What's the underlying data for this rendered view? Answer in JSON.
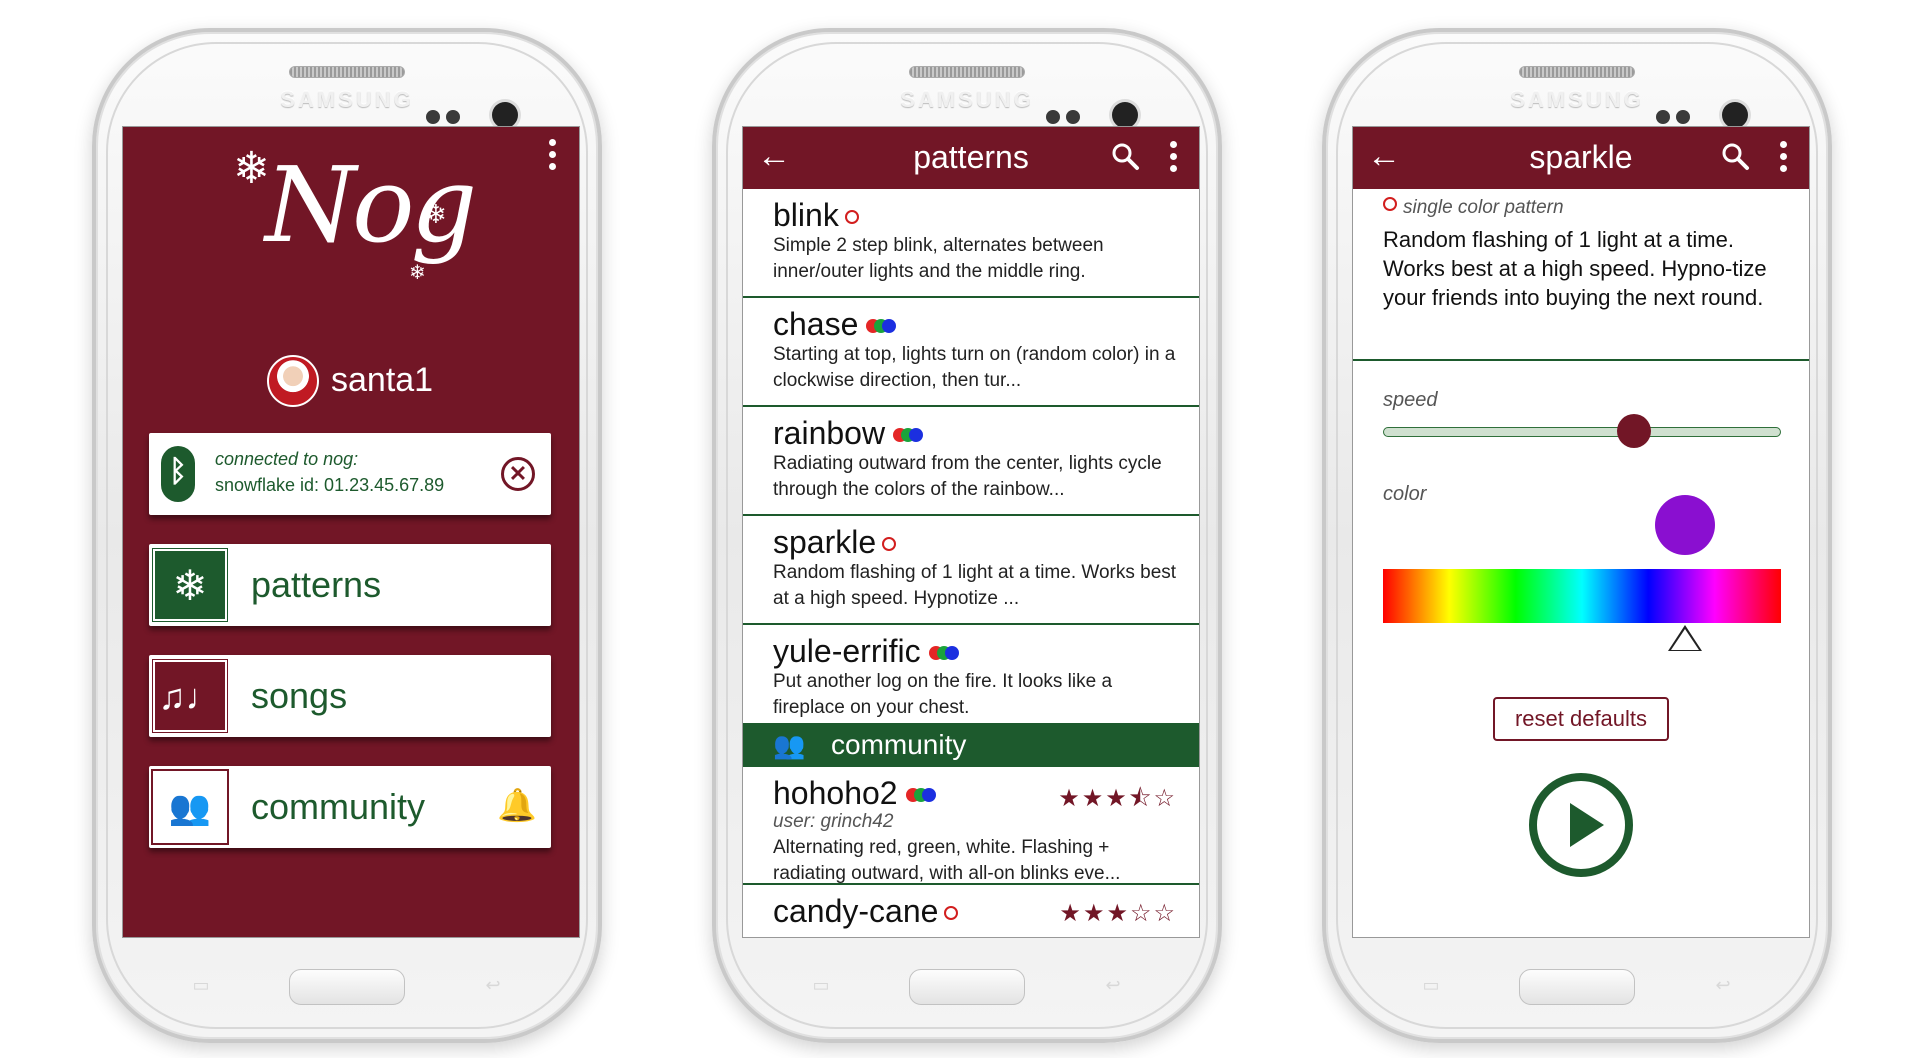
{
  "device_brand": "SAMSUNG",
  "home": {
    "logo_text": "Nog",
    "username": "santa1",
    "connection": {
      "line1": "connected to nog:",
      "line2": "snowflake id: 01.23.45.67.89",
      "bluetooth_icon": "bluetooth-icon",
      "disconnect_icon": "close-circle-icon"
    },
    "nav": [
      {
        "label": "patterns",
        "icon": "snowflake-icon"
      },
      {
        "label": "songs",
        "icon": "music-staff-icon"
      },
      {
        "label": "community",
        "icon": "people-icon",
        "badge_icon": "bell-icon"
      }
    ],
    "colors": {
      "primary": "#721626",
      "accent": "#1d5a2d"
    }
  },
  "patterns_screen": {
    "title": "patterns",
    "items": [
      {
        "name": "blink",
        "type": "single",
        "desc": "Simple 2 step blink, alternates between inner/outer lights and the middle ring."
      },
      {
        "name": "chase",
        "type": "multi",
        "desc": "Starting at top, lights turn on (random color) in a clockwise direction, then tur..."
      },
      {
        "name": "rainbow",
        "type": "multi",
        "desc": "Radiating outward from the center, lights cycle through the colors of the rainbow..."
      },
      {
        "name": "sparkle",
        "type": "single",
        "desc": "Random flashing of 1 light at a time. Works best at a high speed. Hypnotize ..."
      },
      {
        "name": "yule-errific",
        "type": "multi",
        "desc": "Put another log on the fire. It looks like a fireplace on your chest."
      }
    ],
    "community_section": "community",
    "community_items": [
      {
        "name": "hohoho2",
        "type": "multi",
        "user": "user: grinch42",
        "rating": 3.5,
        "stars": "★★★⯪☆",
        "desc": "Alternating red, green, white. Flashing + radiating outward, with all-on blinks eve..."
      },
      {
        "name": "candy-cane",
        "type": "single",
        "rating": 3,
        "stars": "★★★☆☆"
      }
    ]
  },
  "sparkle_screen": {
    "title": "sparkle",
    "type_label": "single color pattern",
    "desc": "Random flashing of 1 light at a time. Works best at a high speed. Hypno-tize your friends into buying the next round.",
    "speed_label": "speed",
    "speed_value": 0.63,
    "color_label": "color",
    "color_value": "#8a0fd0",
    "hue_position": 0.76,
    "reset_label": "reset defaults",
    "play_icon": "play-icon"
  }
}
